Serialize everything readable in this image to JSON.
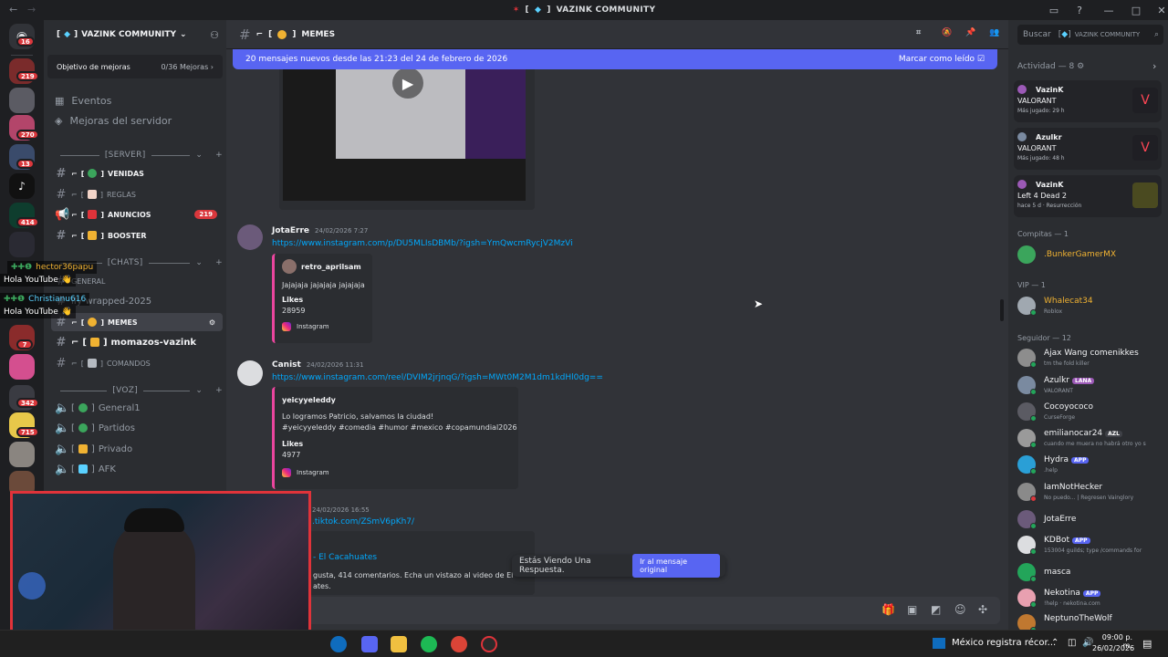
{
  "window": {
    "title": "VAZINK COMMUNITY"
  },
  "server": {
    "name": "VAZINK COMMUNITY",
    "boost_goal_label": "Objetivo de mejoras",
    "boost_goal_value": "0/36 Mejoras",
    "events_label": "Eventos",
    "boosts_label": "Mejoras del servidor"
  },
  "rail_badges": [
    "16",
    "219",
    "270",
    "13",
    "414",
    "7",
    "342",
    "715"
  ],
  "categories": {
    "server": "SERVER",
    "chats": "CHATS",
    "voz": "VOZ"
  },
  "channels": {
    "venidas": "VENIDAS",
    "reglas": "REGLAS",
    "anuncios": "ANUNCIOS",
    "anuncios_badge": "219",
    "booster": "BOOSTER",
    "general": "GENERAL",
    "wrapped": "ify-wrapped-2025",
    "memes": "MEMES",
    "momazos": "momazos-vazink",
    "comandos": "COMANDOS",
    "voice1": "General1",
    "voice2": "Partidos",
    "voice3": "Privado",
    "voice4": "AFK"
  },
  "channel_header": {
    "name": "MEMES"
  },
  "search": {
    "placeholder": "Buscar",
    "scope": "VAZINK COMMUNITY"
  },
  "new_messages_bar": {
    "text": "20 mensajes nuevos desde las 21:23 del 24 de febrero de 2026",
    "action": "Marcar como leído"
  },
  "messages": [
    {
      "author": "JotaErre",
      "timestamp": "24/02/2026 7:27",
      "link": "https://www.instagram.com/p/DU5MLIsDBMb/?igsh=YmQwcmRycjV2MzVi",
      "embed": {
        "author": "retro_aprilsam",
        "text": "Jajajaja jajajaja jajajaja",
        "likes_label": "Likes",
        "likes": "28959",
        "source": "Instagram"
      }
    },
    {
      "author": "Canist",
      "timestamp": "24/02/2026 11:31",
      "link": "https://www.instagram.com/reel/DVIM2jrjnqG/?igsh=MWt0M2M1dm1kdHl0dg==",
      "embed": {
        "author": "yeicyyeleddy",
        "text1": "Lo logramos Patricio, salvamos la ciudad!",
        "text2": "#yeicyyeleddy #comedia #humor #mexico #copamundial2026",
        "likes_label": "Likes",
        "likes": "4977",
        "source": "Instagram"
      }
    },
    {
      "timestamp": "24/02/2026 16:55",
      "link": ".tiktok.com/ZSmV6pKh7/",
      "embed": {
        "title": "- El Cacahuates",
        "text1": "gusta, 414 comentarios. Echa un vistazo al video de El",
        "text2": "ates."
      }
    }
  ],
  "reply_toast": {
    "text": "Estás Viendo Una Respuesta.",
    "button": "Ir al mensaje original"
  },
  "activity": {
    "header": "Actividad — 8",
    "cards": [
      {
        "name": "VazinK",
        "game": "VALORANT",
        "detail": "Más jugado: 29 h"
      },
      {
        "name": "Azulkr",
        "game": "VALORANT",
        "detail": "Más jugado: 48 h"
      },
      {
        "name": "VazinK",
        "game": "Left 4 Dead 2",
        "detail": "hace 5 d",
        "detail2": "Resurrección"
      }
    ]
  },
  "members": {
    "groups": [
      {
        "label": "Compitas — 1",
        "members": [
          {
            "name": ".BunkerGamerMX",
            "status": "",
            "color": "#f0b232"
          }
        ]
      },
      {
        "label": "VIP — 1",
        "members": [
          {
            "name": "Whalecat34",
            "status": "Roblox",
            "color": "#f0b232"
          }
        ]
      },
      {
        "label": "Seguidor — 12",
        "members": [
          {
            "name": "Ajax Wang comenikkes",
            "status": "tm the fold killer",
            "color": "#f2f3f5"
          },
          {
            "name": "Azulkr",
            "tag": "LANA",
            "status": "VALORANT",
            "color": "#f2f3f5"
          },
          {
            "name": "Cocoyococo",
            "status": "CurseForge",
            "color": "#f2f3f5"
          },
          {
            "name": "emilianocar24",
            "tag": "AZL",
            "status": "cuando me muera no habrá otro yo s",
            "color": "#f2f3f5"
          },
          {
            "name": "Hydra",
            "tag": "APP",
            "status": ".help",
            "color": "#f2f3f5"
          },
          {
            "name": "IamNotHecker",
            "status": "No puedo... | Regresen Vainglory",
            "color": "#f2f3f5"
          },
          {
            "name": "JotaErre",
            "status": "",
            "color": "#f2f3f5"
          },
          {
            "name": "KDBot",
            "tag": "APP",
            "status": "153004 guilds; type /commands for",
            "color": "#f2f3f5"
          },
          {
            "name": "masca",
            "status": "",
            "color": "#f2f3f5"
          },
          {
            "name": "Nekotina",
            "tag": "APP",
            "status": "!help · nekotina.com",
            "color": "#f2f3f5"
          },
          {
            "name": "NeptunoTheWolf",
            "status": "",
            "color": "#f2f3f5"
          }
        ]
      }
    ]
  },
  "stream_chat": [
    {
      "user": "hector36papu",
      "text": "Hola YouTube"
    },
    {
      "user": "Christianu616",
      "text": "Hola YouTube"
    }
  ],
  "taskbar": {
    "news": "México registra récor...",
    "time": "09:00 p. m.",
    "date": "26/02/2026"
  },
  "colors": {
    "accent": "#5865f2",
    "background": "#313338",
    "sidebar": "#2b2d31",
    "link": "#00a8fc",
    "embed_border": "#eb459e"
  }
}
